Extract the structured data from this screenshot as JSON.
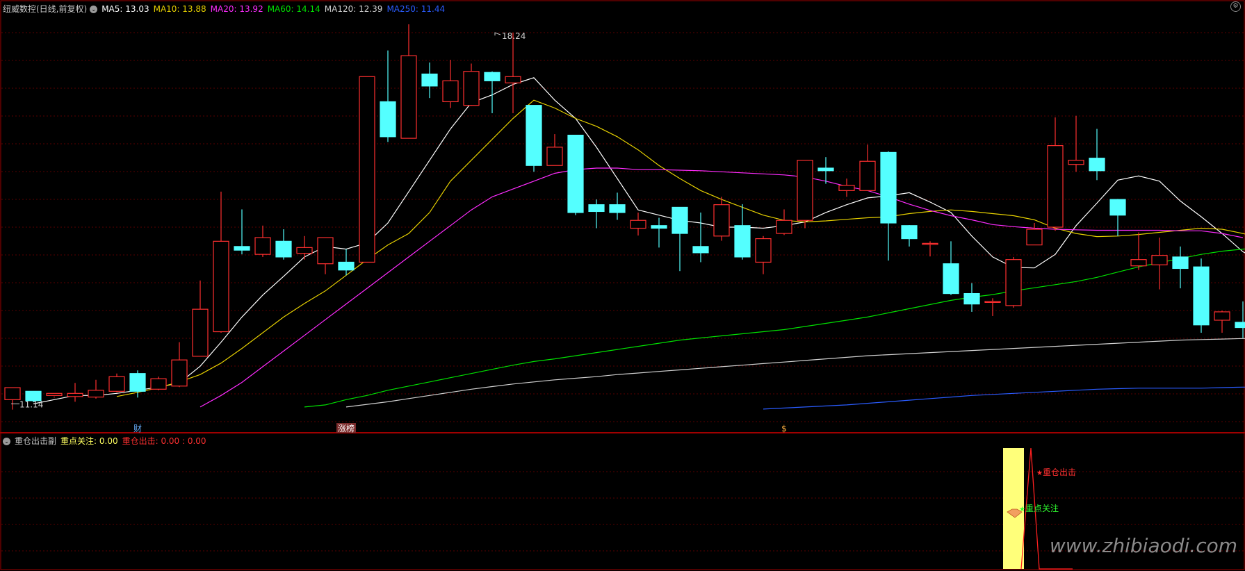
{
  "header": {
    "stock_title": "纽威数控(日线,前复权)",
    "ma_labels": [
      {
        "text": "MA5: 13.03",
        "color": "#ffffff"
      },
      {
        "text": "MA10: 13.88",
        "color": "#e6d000"
      },
      {
        "text": "MA20: 13.92",
        "color": "#ff2cff"
      },
      {
        "text": "MA60: 14.14",
        "color": "#00e000"
      },
      {
        "text": "MA120: 12.39",
        "color": "#d0d0d0"
      },
      {
        "text": "MA250: 11.44",
        "color": "#2a5cff"
      }
    ]
  },
  "sub_header": {
    "indicator_name": "重仓出击副",
    "focus_label": "重点关注: 0.00",
    "strike_label": "重仓出击: 0.00 : 0.00"
  },
  "colors": {
    "up": "#ff3030",
    "down": "#54ffff",
    "grid": "#5a0000",
    "border": "#a00000"
  },
  "chart_data": {
    "type": "candlestick",
    "price_range": [
      10.6,
      18.6
    ],
    "grid": true,
    "annotations": {
      "high": {
        "text": "18.24",
        "value": 18.24,
        "index": 23
      },
      "low": {
        "text": "11.14",
        "value": 11.14,
        "index": 0
      },
      "markers": [
        {
          "text": "财",
          "index": 6,
          "color": "#6ab0ff"
        },
        {
          "text": "涨榜",
          "index": 16,
          "color": "#ffffff",
          "bg": "#7a2b2b"
        },
        {
          "text": "$",
          "index": 37,
          "color": "#ffb040"
        }
      ]
    },
    "candles": [
      [
        11.22,
        11.45,
        11.03,
        11.45
      ],
      [
        11.38,
        11.2,
        11.17,
        11.38
      ],
      [
        11.3,
        11.34,
        11.28,
        11.26
      ],
      [
        11.28,
        11.34,
        11.54,
        11.18
      ],
      [
        11.27,
        11.4,
        11.6,
        11.24
      ],
      [
        11.38,
        11.66,
        11.72,
        11.36
      ],
      [
        11.72,
        11.38,
        11.78,
        11.26
      ],
      [
        11.42,
        11.62,
        11.66,
        11.4
      ],
      [
        11.48,
        11.98,
        12.32,
        11.46
      ],
      [
        12.05,
        12.95,
        13.5,
        12.05
      ],
      [
        12.52,
        14.25,
        15.2,
        12.5
      ],
      [
        14.15,
        14.08,
        14.86,
        14.0
      ],
      [
        14.0,
        14.32,
        14.55,
        13.95
      ],
      [
        14.25,
        13.95,
        14.48,
        13.9
      ],
      [
        14.02,
        14.13,
        14.35,
        13.9
      ],
      [
        13.82,
        14.32,
        14.07,
        13.62
      ],
      [
        13.85,
        13.7,
        14.1,
        13.6
      ],
      [
        13.85,
        17.4,
        17.4,
        13.85
      ],
      [
        16.92,
        16.25,
        17.9,
        16.15
      ],
      [
        16.22,
        17.8,
        18.4,
        16.22
      ],
      [
        17.45,
        17.22,
        17.67,
        16.99
      ],
      [
        16.92,
        17.32,
        17.72,
        16.8
      ],
      [
        16.85,
        17.5,
        17.65,
        16.84
      ],
      [
        17.48,
        17.32,
        17.5,
        16.7
      ],
      [
        17.28,
        17.4,
        18.24,
        16.7
      ],
      [
        16.85,
        15.7,
        16.8,
        15.58
      ],
      [
        15.7,
        16.05,
        16.3,
        15.7
      ],
      [
        16.28,
        14.8,
        16.28,
        14.75
      ],
      [
        14.95,
        14.82,
        15.05,
        14.5
      ],
      [
        14.95,
        14.8,
        15.18,
        14.66
      ],
      [
        14.5,
        14.65,
        14.8,
        14.36
      ],
      [
        14.55,
        14.5,
        14.7,
        14.13
      ],
      [
        14.9,
        14.4,
        14.85,
        13.68
      ],
      [
        14.15,
        14.03,
        14.8,
        13.85
      ],
      [
        14.35,
        14.95,
        15.1,
        14.26
      ],
      [
        14.55,
        13.95,
        14.96,
        13.9
      ],
      [
        13.85,
        14.3,
        14.35,
        13.62
      ],
      [
        14.4,
        14.65,
        14.86,
        14.37
      ],
      [
        14.65,
        15.8,
        15.8,
        14.5
      ],
      [
        15.65,
        15.6,
        15.86,
        15.35
      ],
      [
        15.22,
        15.32,
        15.45,
        15.1
      ],
      [
        15.22,
        15.78,
        16.1,
        15.22
      ],
      [
        15.95,
        14.6,
        15.97,
        13.88
      ],
      [
        14.55,
        14.3,
        14.56,
        14.15
      ],
      [
        14.2,
        14.21,
        14.25,
        13.96
      ],
      [
        13.82,
        13.25,
        14.25,
        13.22
      ],
      [
        13.25,
        13.05,
        13.45,
        12.9
      ],
      [
        13.1,
        13.1,
        13.16,
        12.82
      ],
      [
        13.02,
        13.9,
        13.95,
        12.98
      ],
      [
        14.18,
        14.48,
        14.6,
        14.18
      ],
      [
        14.52,
        16.08,
        16.62,
        14.45
      ],
      [
        15.72,
        15.8,
        16.65,
        15.58
      ],
      [
        15.84,
        15.6,
        16.4,
        15.42
      ],
      [
        15.05,
        14.75,
        15.06,
        14.35
      ],
      [
        13.78,
        13.9,
        14.42,
        13.7
      ],
      [
        13.8,
        13.98,
        14.32,
        13.33
      ],
      [
        13.95,
        13.73,
        14.15,
        13.35
      ],
      [
        13.76,
        12.65,
        13.92,
        12.5
      ],
      [
        12.74,
        12.9,
        12.92,
        12.5
      ],
      [
        12.7,
        12.6,
        13.1,
        12.4
      ]
    ],
    "series": [
      {
        "name": "MA5",
        "color": "#ffffff",
        "start": 1,
        "values": [
          11.14,
          11.22,
          11.3,
          11.3,
          11.34,
          11.4,
          11.46,
          11.54,
          11.86,
          12.32,
          12.8,
          13.22,
          13.58,
          13.95,
          14.15,
          14.1,
          14.22,
          14.6,
          15.2,
          15.8,
          16.4,
          16.9,
          17.05,
          17.25,
          17.38,
          16.95,
          16.6,
          16.05,
          15.45,
          14.85,
          14.75,
          14.65,
          14.6,
          14.52,
          14.52,
          14.5,
          14.55,
          14.62,
          14.8,
          14.95,
          15.08,
          15.12,
          15.18,
          15.0,
          14.8,
          14.35,
          13.95,
          13.75,
          13.74,
          14.0,
          14.55,
          14.98,
          15.42,
          15.5,
          15.4,
          15.02,
          14.72,
          14.4,
          14.05,
          13.85
        ]
      },
      {
        "name": "MA10",
        "color": "#e6d000",
        "start": 5,
        "values": [
          11.28,
          11.36,
          11.45,
          11.56,
          11.7,
          11.92,
          12.2,
          12.5,
          12.8,
          13.06,
          13.3,
          13.6,
          13.9,
          14.18,
          14.4,
          14.8,
          15.4,
          15.8,
          16.2,
          16.6,
          16.95,
          16.8,
          16.6,
          16.45,
          16.25,
          16.0,
          15.7,
          15.45,
          15.22,
          15.05,
          14.9,
          14.75,
          14.65,
          14.62,
          14.64,
          14.67,
          14.7,
          14.72,
          14.78,
          14.82,
          14.85,
          14.82,
          14.78,
          14.74,
          14.66,
          14.5,
          14.4,
          14.34,
          14.35,
          14.38,
          14.42,
          14.46,
          14.5,
          14.48,
          14.4,
          14.3,
          14.2
        ]
      },
      {
        "name": "MA20",
        "color": "#ff2cff",
        "start": 9,
        "values": [
          11.08,
          11.3,
          11.55,
          11.85,
          12.15,
          12.45,
          12.75,
          13.05,
          13.35,
          13.65,
          13.95,
          14.25,
          14.55,
          14.85,
          15.1,
          15.25,
          15.4,
          15.55,
          15.62,
          15.65,
          15.65,
          15.62,
          15.62,
          15.61,
          15.6,
          15.58,
          15.56,
          15.54,
          15.52,
          15.48,
          15.4,
          15.3,
          15.22,
          15.1,
          14.96,
          14.84,
          14.74,
          14.66,
          14.57,
          14.53,
          14.5,
          14.48,
          14.47,
          14.46,
          14.46,
          14.46,
          14.46,
          14.45,
          14.45,
          14.4,
          14.32
        ]
      },
      {
        "name": "MA60",
        "color": "#00e000",
        "start": 14,
        "values": [
          11.08,
          11.12,
          11.22,
          11.3,
          11.4,
          11.48,
          11.56,
          11.64,
          11.72,
          11.8,
          11.88,
          11.95,
          12.0,
          12.06,
          12.12,
          12.18,
          12.24,
          12.3,
          12.36,
          12.4,
          12.44,
          12.48,
          12.52,
          12.56,
          12.62,
          12.68,
          12.74,
          12.8,
          12.88,
          12.96,
          13.04,
          13.12,
          13.18,
          13.23,
          13.3,
          13.36,
          13.42,
          13.48,
          13.56,
          13.66,
          13.76,
          13.84,
          13.92,
          14.0,
          14.06,
          14.1,
          14.14
        ]
      },
      {
        "name": "MA120",
        "color": "#d0d0d0",
        "start": 16,
        "values": [
          11.08,
          11.13,
          11.18,
          11.24,
          11.3,
          11.36,
          11.42,
          11.47,
          11.52,
          11.56,
          11.6,
          11.63,
          11.66,
          11.7,
          11.73,
          11.76,
          11.79,
          11.82,
          11.85,
          11.88,
          11.91,
          11.94,
          11.97,
          12.0,
          12.03,
          12.06,
          12.08,
          12.1,
          12.12,
          12.14,
          12.16,
          12.18,
          12.2,
          12.22,
          12.24,
          12.26,
          12.28,
          12.3,
          12.32,
          12.34,
          12.36,
          12.37,
          12.38,
          12.39,
          12.39
        ]
      },
      {
        "name": "MA250",
        "color": "#2a5cff",
        "start": 36,
        "values": [
          11.04,
          11.06,
          11.08,
          11.1,
          11.12,
          11.15,
          11.18,
          11.21,
          11.24,
          11.27,
          11.3,
          11.32,
          11.34,
          11.36,
          11.38,
          11.4,
          11.42,
          11.43,
          11.44,
          11.44,
          11.44,
          11.44,
          11.45,
          11.46,
          11.46
        ]
      }
    ],
    "sub_chart": {
      "signal_index": 48,
      "labels": [
        {
          "text": "重仓出击",
          "color": "#ff3030"
        },
        {
          "text": "重点关注",
          "color": "#30ff30"
        }
      ],
      "signal_bar_color": "#ffff7a",
      "triangle_color": "#ff2020"
    }
  },
  "watermark": "www.zhibiaodi.com"
}
